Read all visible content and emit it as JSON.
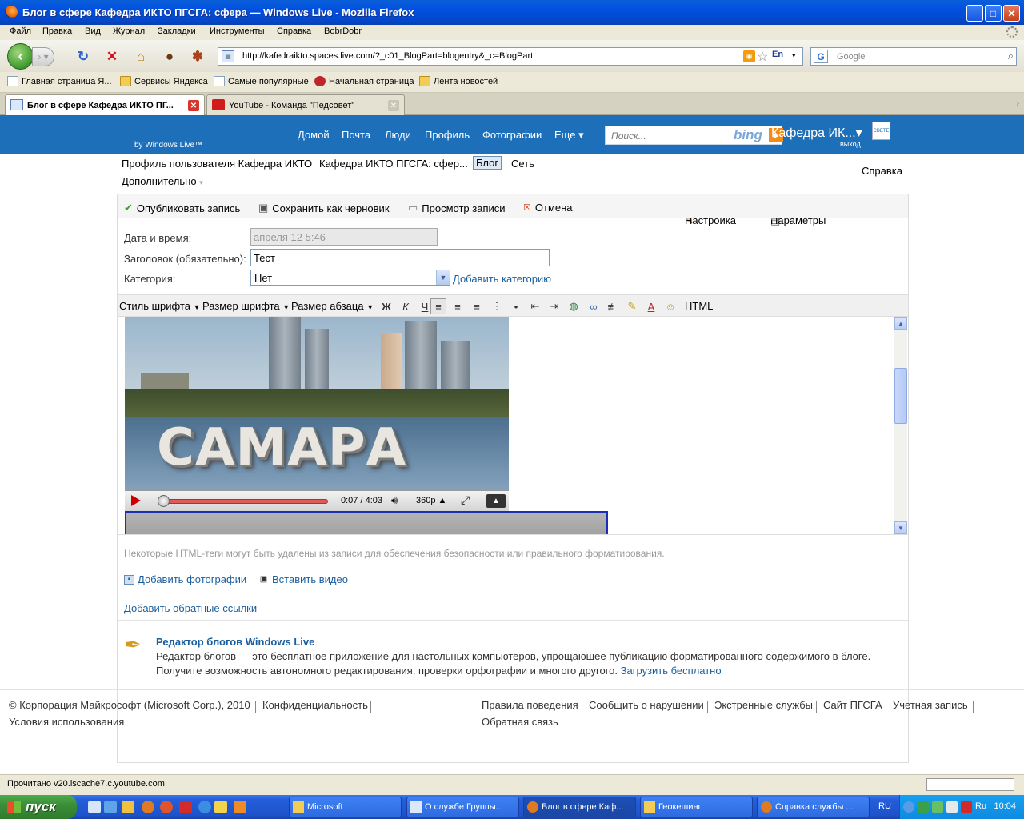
{
  "window": {
    "title": "Блог в сфере Кафедра ИКТО ПГСГА: сфера — Windows Live - Mozilla Firefox",
    "min": "_",
    "max": "□",
    "close": "✕"
  },
  "menu": [
    "Файл",
    "Правка",
    "Вид",
    "Журнал",
    "Закладки",
    "Инструменты",
    "Справка",
    "BobrDobr"
  ],
  "nav": {
    "url": "http://kafedraikto.spaces.live.com/?_c01_BlogPart=blogentry&_c=BlogPart",
    "lang": "En",
    "search_placeholder": "Google",
    "search_engine_glyph": "G"
  },
  "bookmarks": [
    {
      "label": "Главная страница Я...",
      "icon": "page-icon"
    },
    {
      "label": "Сервисы Яндекса",
      "icon": "folder-icon"
    },
    {
      "label": "Самые популярные",
      "icon": "page-icon"
    },
    {
      "label": "Начальная страница",
      "icon": "firefox-icon"
    },
    {
      "label": "Лента новостей",
      "icon": "rss-folder-icon"
    }
  ],
  "tabs": [
    {
      "label": "Блог в сфере Кафедра ИКТО ПГ...",
      "active": true
    },
    {
      "label": "YouTube - Команда \"Педсовет\"",
      "active": false
    }
  ],
  "live": {
    "nav": [
      "Домой",
      "Почта",
      "Люди",
      "Профиль",
      "Фотографии",
      "Еще ▾"
    ],
    "by": "by Windows Live™",
    "search_placeholder": "Поиск...",
    "bing": "bing",
    "user": "Кафедра ИК...▾",
    "exit": "выход",
    "avatar": "СВЕТЕ"
  },
  "subnav": {
    "items": [
      "Профиль пользователя Кафедра ИКТО",
      "Кафедра ИКТО ПГСГА: сфер...",
      "Блог",
      "Сеть"
    ],
    "more": "Дополнительно",
    "right": [
      "Настройка",
      "Параметры",
      "Справка"
    ]
  },
  "actions": [
    "Опубликовать запись",
    "Сохранить как черновик",
    "Просмотр записи",
    "Отмена"
  ],
  "form": {
    "date_label": "Дата и время:",
    "date_value": "апреля 12 5:46",
    "title_label": "Заголовок (обязательно):",
    "title_value": "Тест",
    "category_label": "Категория:",
    "category_value": "Нет",
    "add_category": "Добавить категорию"
  },
  "format": {
    "font_style": "Стиль шрифта",
    "font_size": "Размер шрифта",
    "para_size": "Размер абзаца",
    "bold": "Ж",
    "italic": "К",
    "underline": "Ч",
    "html": "HTML"
  },
  "video": {
    "caption": "САМАРА",
    "time": "0:07 / 4:03",
    "quality": "360p",
    "progress": 0.03
  },
  "note": "Некоторые HTML-теги могут быть удалены из записи для обеспечения безопасности или правильного форматирования.",
  "add_photos": "Добавить фотографии",
  "insert_video": "Вставить видео",
  "backlinks": "Добавить обратные ссылки",
  "promo": {
    "title": "Редактор блогов Windows Live",
    "text": "Редактор блогов — это бесплатное приложение для настольных компьютеров, упрощающее публикацию форматированного содержимого в блоге. Получите возможность автономного редактирования, проверки орфографии и многого другого.",
    "link": "Загрузить бесплатно"
  },
  "footer": {
    "left": [
      "© Корпорация Майкрософт (Microsoft Corp.), 2010",
      "Конфиденциальность",
      "Условия использования"
    ],
    "right": [
      "Правила поведения",
      "Сообщить о нарушении",
      "Экстренные службы",
      "Сайт ПГСГА",
      "Учетная запись",
      "Обратная связь"
    ]
  },
  "status": "Прочитано v20.lscache7.c.youtube.com",
  "taskbar": {
    "start": "пуск",
    "tasks": [
      {
        "label": "Microsoft",
        "active": false
      },
      {
        "label": "О службе Группы...",
        "active": false
      },
      {
        "label": "Блог в сфере Каф...",
        "active": true
      },
      {
        "label": "Геокешинг",
        "active": false
      },
      {
        "label": "Справка службы ...",
        "active": false
      }
    ],
    "lang": "RU",
    "tray_lang": "Ru",
    "clock": "10:04"
  }
}
